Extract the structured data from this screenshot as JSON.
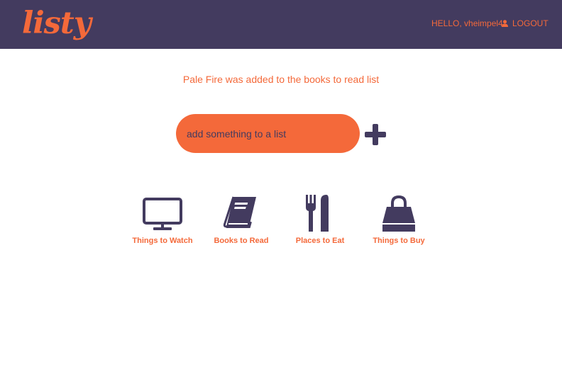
{
  "app": {
    "logo": "listy"
  },
  "header": {
    "greeting": "HELLO, vheimpel4",
    "logout_label": "LOGOUT"
  },
  "flash": {
    "message": "Pale Fire was added to the books to read list"
  },
  "add_form": {
    "placeholder": "add something to a list",
    "value": ""
  },
  "categories": [
    {
      "label": "Things to Watch",
      "icon": "tv-icon"
    },
    {
      "label": "Books to Read",
      "icon": "book-icon"
    },
    {
      "label": "Places to Eat",
      "icon": "fork-knife-icon"
    },
    {
      "label": "Things to Buy",
      "icon": "shopping-bag-icon"
    }
  ],
  "colors": {
    "brand": "#f4693a",
    "nav": "#433b5f",
    "background": "#ffffff"
  }
}
